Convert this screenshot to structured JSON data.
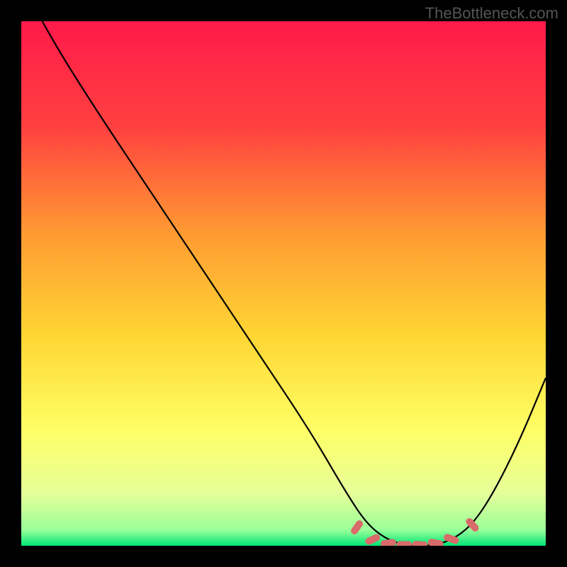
{
  "watermark": "TheBottleneck.com",
  "chart_data": {
    "type": "line",
    "title": "",
    "xlabel": "",
    "ylabel": "",
    "xlim": [
      0,
      100
    ],
    "ylim": [
      0,
      100
    ],
    "gradient_stops": [
      {
        "offset": 0,
        "color": "#ff1a4a"
      },
      {
        "offset": 20,
        "color": "#ff4040"
      },
      {
        "offset": 40,
        "color": "#ff9933"
      },
      {
        "offset": 60,
        "color": "#ffd633"
      },
      {
        "offset": 78,
        "color": "#ffff66"
      },
      {
        "offset": 90,
        "color": "#e6ff99"
      },
      {
        "offset": 97,
        "color": "#99ff99"
      },
      {
        "offset": 100,
        "color": "#00e676"
      }
    ],
    "series": [
      {
        "name": "bottleneck-curve",
        "color": "#000000",
        "points": [
          {
            "x": 4,
            "y": 100
          },
          {
            "x": 8,
            "y": 93
          },
          {
            "x": 15,
            "y": 82
          },
          {
            "x": 25,
            "y": 67
          },
          {
            "x": 35,
            "y": 52
          },
          {
            "x": 45,
            "y": 37
          },
          {
            "x": 55,
            "y": 22
          },
          {
            "x": 62,
            "y": 10
          },
          {
            "x": 66,
            "y": 4
          },
          {
            "x": 70,
            "y": 1
          },
          {
            "x": 74,
            "y": 0
          },
          {
            "x": 78,
            "y": 0
          },
          {
            "x": 82,
            "y": 1
          },
          {
            "x": 86,
            "y": 4
          },
          {
            "x": 90,
            "y": 10
          },
          {
            "x": 95,
            "y": 20
          },
          {
            "x": 100,
            "y": 32
          }
        ]
      }
    ],
    "markers": [
      {
        "x": 64,
        "y": 3.5,
        "rot": -55
      },
      {
        "x": 67,
        "y": 1.2,
        "rot": -25
      },
      {
        "x": 70,
        "y": 0.5,
        "rot": -8
      },
      {
        "x": 73,
        "y": 0.2,
        "rot": 0
      },
      {
        "x": 76,
        "y": 0.2,
        "rot": 4
      },
      {
        "x": 79,
        "y": 0.5,
        "rot": 10
      },
      {
        "x": 82,
        "y": 1.3,
        "rot": 20
      },
      {
        "x": 86,
        "y": 4.0,
        "rot": 48
      }
    ]
  }
}
